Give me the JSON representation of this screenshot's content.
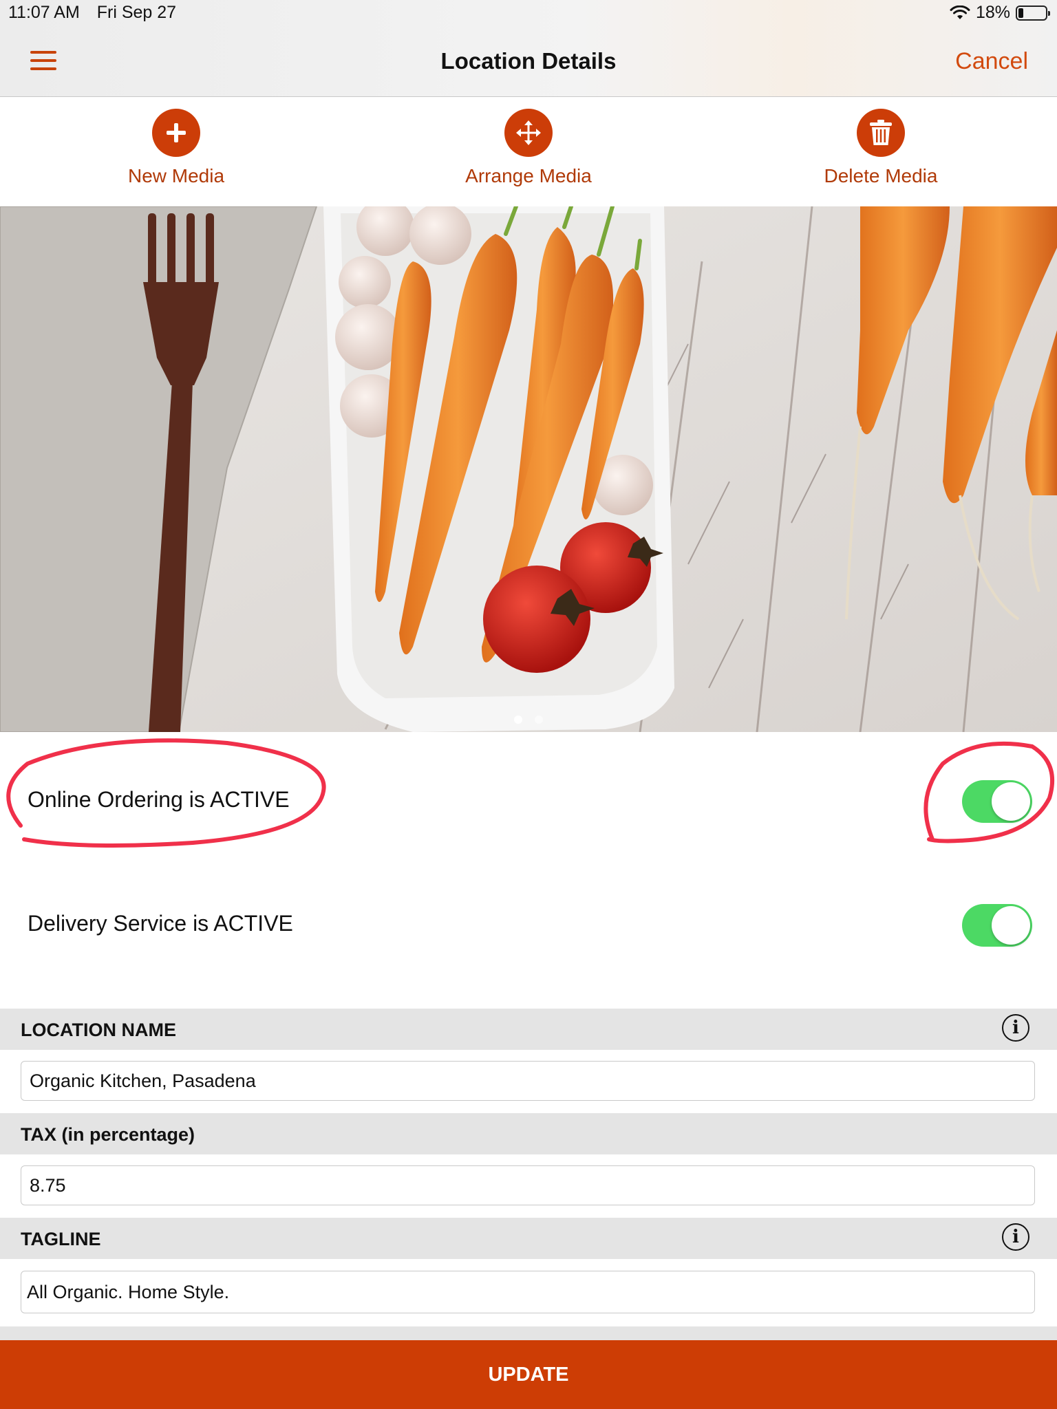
{
  "status_bar": {
    "time": "11:07 AM",
    "date": "Fri Sep 27",
    "battery": "18%",
    "battery_level": 0.18
  },
  "nav": {
    "title": "Location Details",
    "cancel_label": "Cancel"
  },
  "toolbar": {
    "new_media": "New Media",
    "arrange_media": "Arrange Media",
    "delete_media": "Delete Media"
  },
  "carousel": {
    "page_count": 2,
    "current_page": 1
  },
  "toggles": {
    "online_ordering": {
      "label": "Online Ordering is ACTIVE",
      "on": true
    },
    "delivery_service": {
      "label": "Delivery Service is ACTIVE",
      "on": true
    }
  },
  "form": {
    "location_name": {
      "header": "LOCATION NAME",
      "value": "Organic Kitchen, Pasadena"
    },
    "tax": {
      "header": "TAX (in percentage)",
      "value": "8.75"
    },
    "tagline": {
      "header": "TAGLINE",
      "value": "All Organic. Home Style."
    }
  },
  "info_glyph": "i",
  "update_label": "UPDATE",
  "colors": {
    "accent": "#cd3d05",
    "toggle_on": "#4cd964",
    "annotation": "#f0304a"
  }
}
